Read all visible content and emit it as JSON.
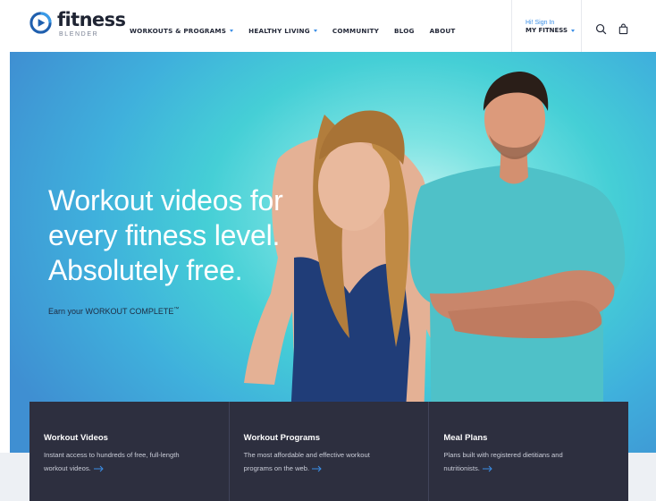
{
  "brand": {
    "name": "fitness",
    "sub": "BLENDER",
    "accent": "#3a8ee6"
  },
  "nav": {
    "items": [
      {
        "label": "WORKOUTS & PROGRAMS",
        "has_caret": true
      },
      {
        "label": "HEALTHY LIVING",
        "has_caret": true
      },
      {
        "label": "COMMUNITY",
        "has_caret": false
      },
      {
        "label": "BLOG",
        "has_caret": false
      },
      {
        "label": "ABOUT",
        "has_caret": false
      }
    ]
  },
  "account": {
    "greeting": "Hi! Sign In",
    "menu_label": "MY FITNESS"
  },
  "icons": {
    "search": "search-icon",
    "cart": "shopping-bag-icon"
  },
  "hero": {
    "headline_lines": [
      "Workout videos for",
      "every fitness level.",
      "Absolutely free."
    ],
    "tagline": "Earn your WORKOUT COMPLETE",
    "tagline_mark": "™",
    "bg_colors": [
      "#3f8fd2",
      "#45cfd6",
      "#c8f4f3"
    ]
  },
  "cards": [
    {
      "title": "Workout Videos",
      "desc": "Instant access to hundreds of free, full-length workout videos."
    },
    {
      "title": "Workout Programs",
      "desc": "The most affordable and effective workout programs on the web."
    },
    {
      "title": "Meal Plans",
      "desc": "Plans built with registered dietitians and nutritionists."
    }
  ]
}
